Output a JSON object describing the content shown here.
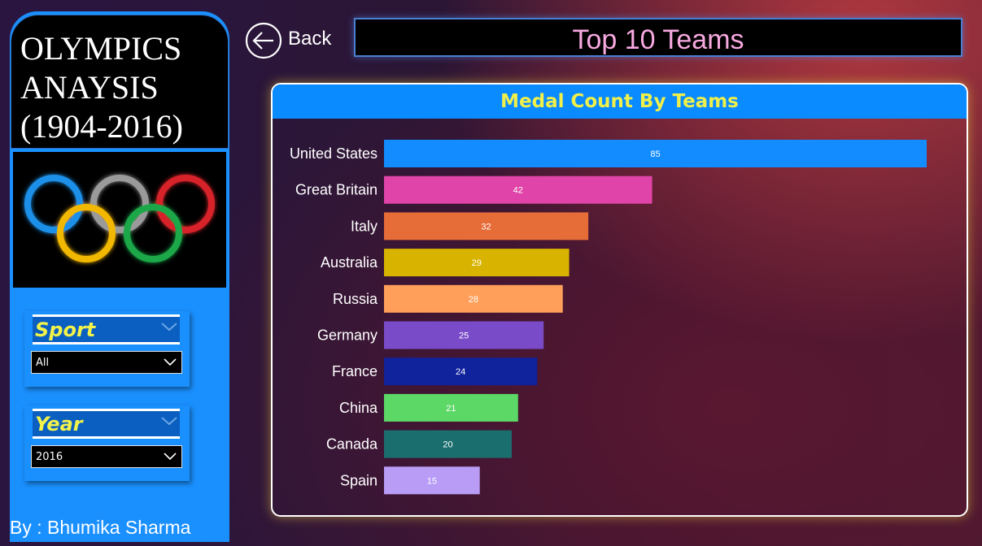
{
  "sidebar": {
    "title_lines": [
      "OLYMPICS",
      "ANAYSIS",
      "(1904-2016)"
    ],
    "author": "By : Bhumika Sharma"
  },
  "filters": [
    {
      "label": "Sport",
      "value": "All"
    },
    {
      "label": "Year",
      "value": "2016"
    }
  ],
  "header": {
    "back_label": "Back",
    "page_title": "Top 10 Teams"
  },
  "colors": {
    "sidebar_blue": "#1a90ff",
    "chart_header_blue": "#0a8bff",
    "title_pink": "#f7a9e0",
    "label_yellow": "#f0f04a"
  },
  "chart_data": {
    "type": "bar",
    "orientation": "horizontal",
    "title": "Medal Count By Teams",
    "categories": [
      "United States",
      "Great Britain",
      "Italy",
      "Australia",
      "Russia",
      "Germany",
      "France",
      "China",
      "Canada",
      "Spain"
    ],
    "values": [
      85,
      42,
      32,
      29,
      28,
      25,
      24,
      21,
      20,
      15
    ],
    "bar_colors": [
      "#128cff",
      "#e044a8",
      "#e66c38",
      "#d8b400",
      "#ff9f5a",
      "#7a4bc8",
      "#10229c",
      "#5cd866",
      "#1a6e6e",
      "#b89cf6"
    ],
    "xlim": [
      0,
      85
    ],
    "data_labels": true,
    "grid": false
  }
}
